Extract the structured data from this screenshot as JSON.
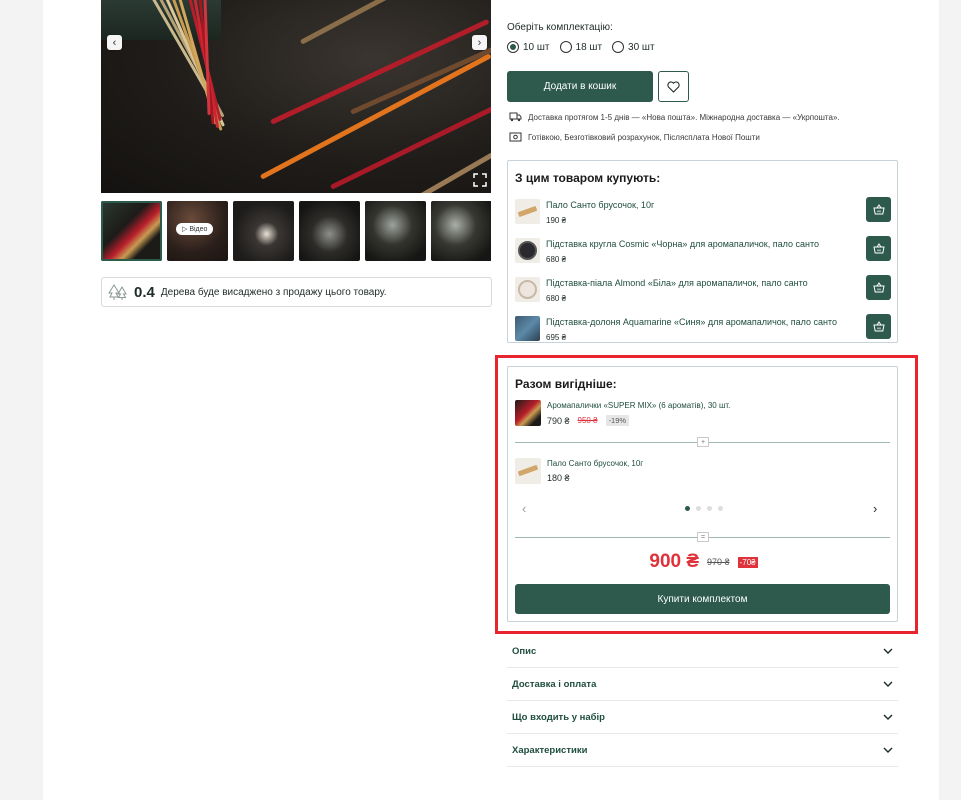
{
  "gallery": {
    "prev_icon": "chevron-left-icon",
    "next_icon": "chevron-right-icon",
    "expand_icon": "expand-icon",
    "video_label": "▷ Відео"
  },
  "trees": {
    "count": "0.4",
    "text": "Дерева буде висаджено з продажу цього товару."
  },
  "product": {
    "options_label": "Оберіть комплектацію:",
    "options": [
      "10 шт",
      "18 шт",
      "30 шт"
    ],
    "selected_option": "10 шт",
    "add_to_cart": "Додати в кошик",
    "delivery_text": "Доставка протягом 1-5 днів — «Нова пошта». Міжнародна доставка — «Укрпошта».",
    "payment_text": "Готівкою, Безготівковий розрахунок, Післясплата Нової Пошти"
  },
  "related": {
    "title": "З цим товаром купують:",
    "items": [
      {
        "name": "Пало Санто брусочок, 10г",
        "price": "190 ₴"
      },
      {
        "name": "Підставка кругла Cosmic «Чорна» для аромапаличок, пало санто",
        "price": "680 ₴"
      },
      {
        "name": "Підставка-піала Almond «Біла» для аромапаличок, пало санто",
        "price": "680 ₴"
      },
      {
        "name": "Підставка-долоня Aquamarine «Синя» для аромапаличок, пало санто",
        "price": "695 ₴"
      }
    ]
  },
  "bundle": {
    "title": "Разом вигідніше:",
    "item1": {
      "name": "Аромапалички «SUPER MIX» (6 ароматів), 30 шт.",
      "price": "790 ₴",
      "old_price": "950 ₴",
      "discount": "-19%"
    },
    "plus": "+",
    "item2": {
      "name": "Пало Санто брусочок, 10г",
      "price": "180 ₴"
    },
    "equals": "=",
    "total": "900 ₴",
    "total_old": "970 ₴",
    "total_discount": "-70₴",
    "buy_button": "Купити комплектом",
    "pager_dots": 4,
    "active_dot": 0
  },
  "accordion": [
    "Опис",
    "Доставка і оплата",
    "Що входить у набір",
    "Характеристики"
  ],
  "colors": {
    "brand_green": "#2d5a4c",
    "price_red": "#e0323b",
    "highlight_red": "#e8242f"
  }
}
